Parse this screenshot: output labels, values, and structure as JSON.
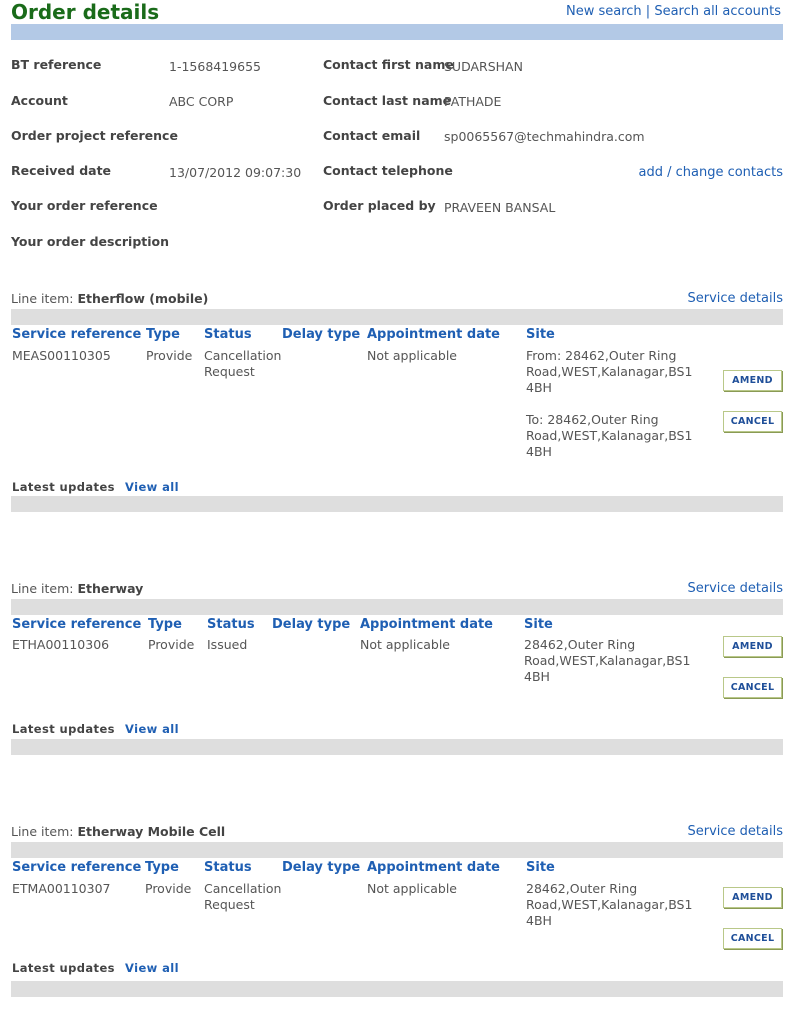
{
  "header": {
    "title": "Order details",
    "new_search": "New search",
    "separator": "|",
    "search_all": "Search all accounts"
  },
  "details": {
    "bt_reference_label": "BT reference",
    "bt_reference": "1-1568419655",
    "account_label": "Account",
    "account": "ABC CORP",
    "order_project_reference_label": "Order project reference",
    "received_date_label": "Received date",
    "received_date": "13/07/2012 09:07:30",
    "your_order_reference_label": "Your order reference",
    "your_order_description_label": "Your order description",
    "contact_first_name_label": "Contact first name",
    "contact_first_name": "SUDARSHAN",
    "contact_last_name_label": "Contact last name",
    "contact_last_name": "PATHADE",
    "contact_email_label": "Contact email",
    "contact_email": "sp0065567@techmahindra.com",
    "contact_telephone_label": "Contact telephone",
    "add_change_contacts": "add / change contacts",
    "order_placed_by_label": "Order placed by",
    "order_placed_by": "PRAVEEN BANSAL"
  },
  "common": {
    "line_item_prefix": "Line item:",
    "service_details": "Service details",
    "col_service_reference": "Service reference",
    "col_type": "Type",
    "col_status": "Status",
    "col_delay_type": "Delay type",
    "col_appointment_date": "Appointment date",
    "col_site": "Site",
    "amend": "AMEND",
    "cancel": "CANCEL",
    "latest_updates": "Latest updates",
    "view_all": "View all"
  },
  "line_items": [
    {
      "name": "Etherflow (mobile)",
      "service_reference": "MEAS00110305",
      "type": "Provide",
      "status": "Cancellation Request",
      "delay_type": "",
      "appointment_date": "Not applicable",
      "site_from": "From: 28462,Outer Ring Road,WEST,Kalanagar,BS1 4BH",
      "site_to": "To: 28462,Outer Ring Road,WEST,Kalanagar,BS1 4BH"
    },
    {
      "name": "Etherway",
      "service_reference": "ETHA00110306",
      "type": "Provide",
      "status": "Issued",
      "delay_type": "",
      "appointment_date": "Not applicable",
      "site": "28462,Outer Ring Road,WEST,Kalanagar,BS1 4BH"
    },
    {
      "name": "Etherway Mobile Cell",
      "service_reference": "ETMA00110307",
      "type": "Provide",
      "status": "Cancellation Request",
      "delay_type": "",
      "appointment_date": "Not applicable",
      "site": "28462,Outer Ring Road,WEST,Kalanagar,BS1 4BH"
    }
  ]
}
